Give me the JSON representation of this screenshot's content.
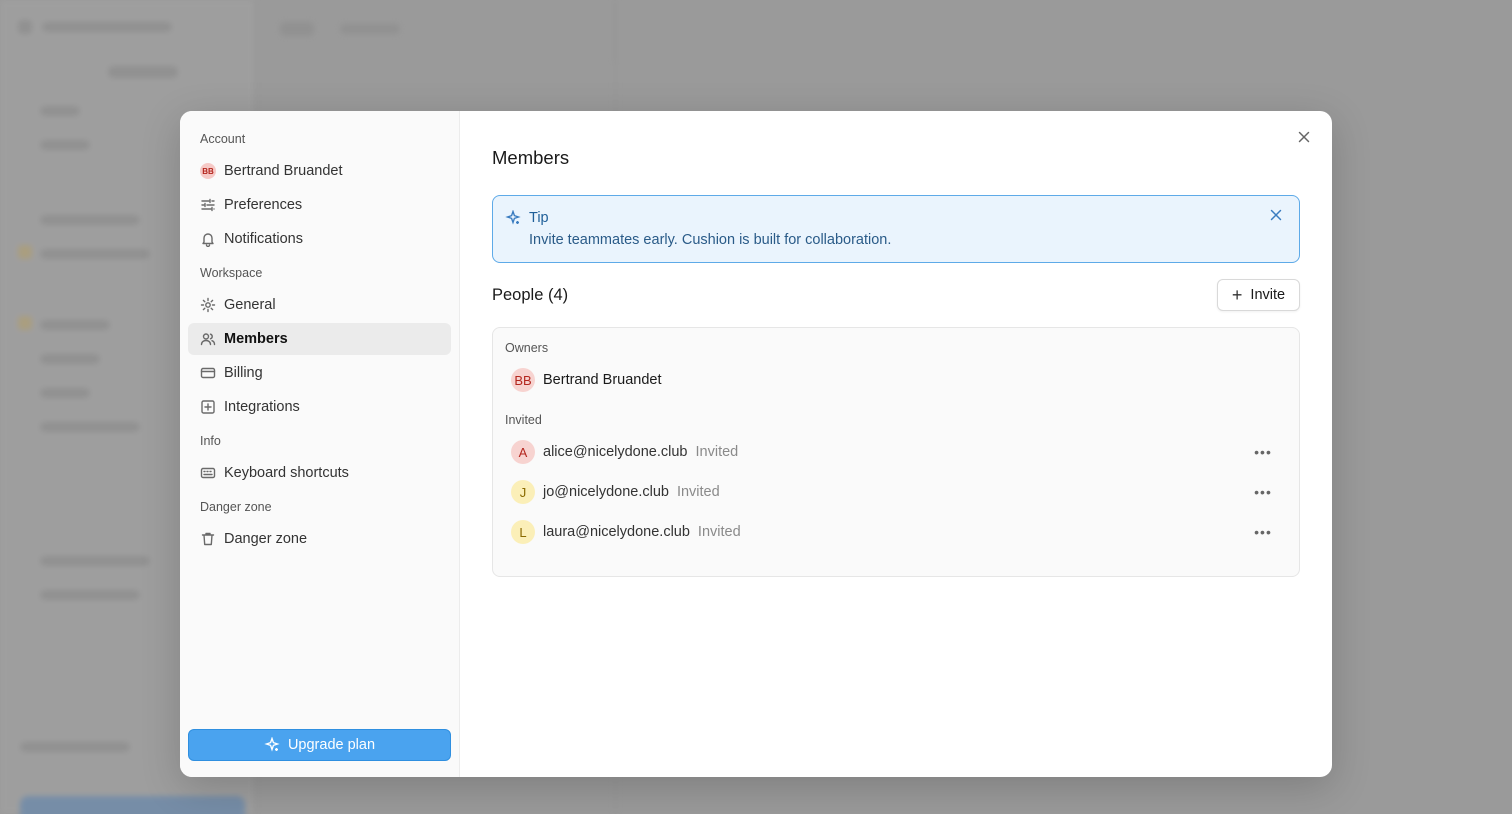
{
  "sidebar": {
    "sections": [
      {
        "title": "Account"
      },
      {
        "title": "Workspace"
      },
      {
        "title": "Info"
      },
      {
        "title": "Danger zone"
      }
    ],
    "account_user": {
      "initials": "BB",
      "name": "Bertrand Bruandet"
    },
    "items": {
      "preferences": "Preferences",
      "notifications": "Notifications",
      "general": "General",
      "members": "Members",
      "billing": "Billing",
      "integrations": "Integrations",
      "keyboard_shortcuts": "Keyboard shortcuts",
      "danger_zone": "Danger zone"
    },
    "active_item": "members",
    "upgrade_label": "Upgrade plan"
  },
  "main": {
    "title": "Members",
    "tip": {
      "title": "Tip",
      "text": "Invite teammates early. Cushion is built for collaboration."
    },
    "people_title": "People (4)",
    "invite_label": "Invite",
    "owners_label": "Owners",
    "invited_label": "Invited",
    "owners": [
      {
        "initials": "BB",
        "name": "Bertrand Bruandet"
      }
    ],
    "invited": [
      {
        "initial": "A",
        "email": "alice@nicelydone.club",
        "status": "Invited",
        "color": "red"
      },
      {
        "initial": "J",
        "email": "jo@nicelydone.club",
        "status": "Invited",
        "color": "yellow"
      },
      {
        "initial": "L",
        "email": "laura@nicelydone.club",
        "status": "Invited",
        "color": "yellow"
      }
    ]
  },
  "colors": {
    "accent": "#4aa3ef",
    "tip_bg": "#eaf4fd",
    "tip_border": "#5eaae8"
  }
}
